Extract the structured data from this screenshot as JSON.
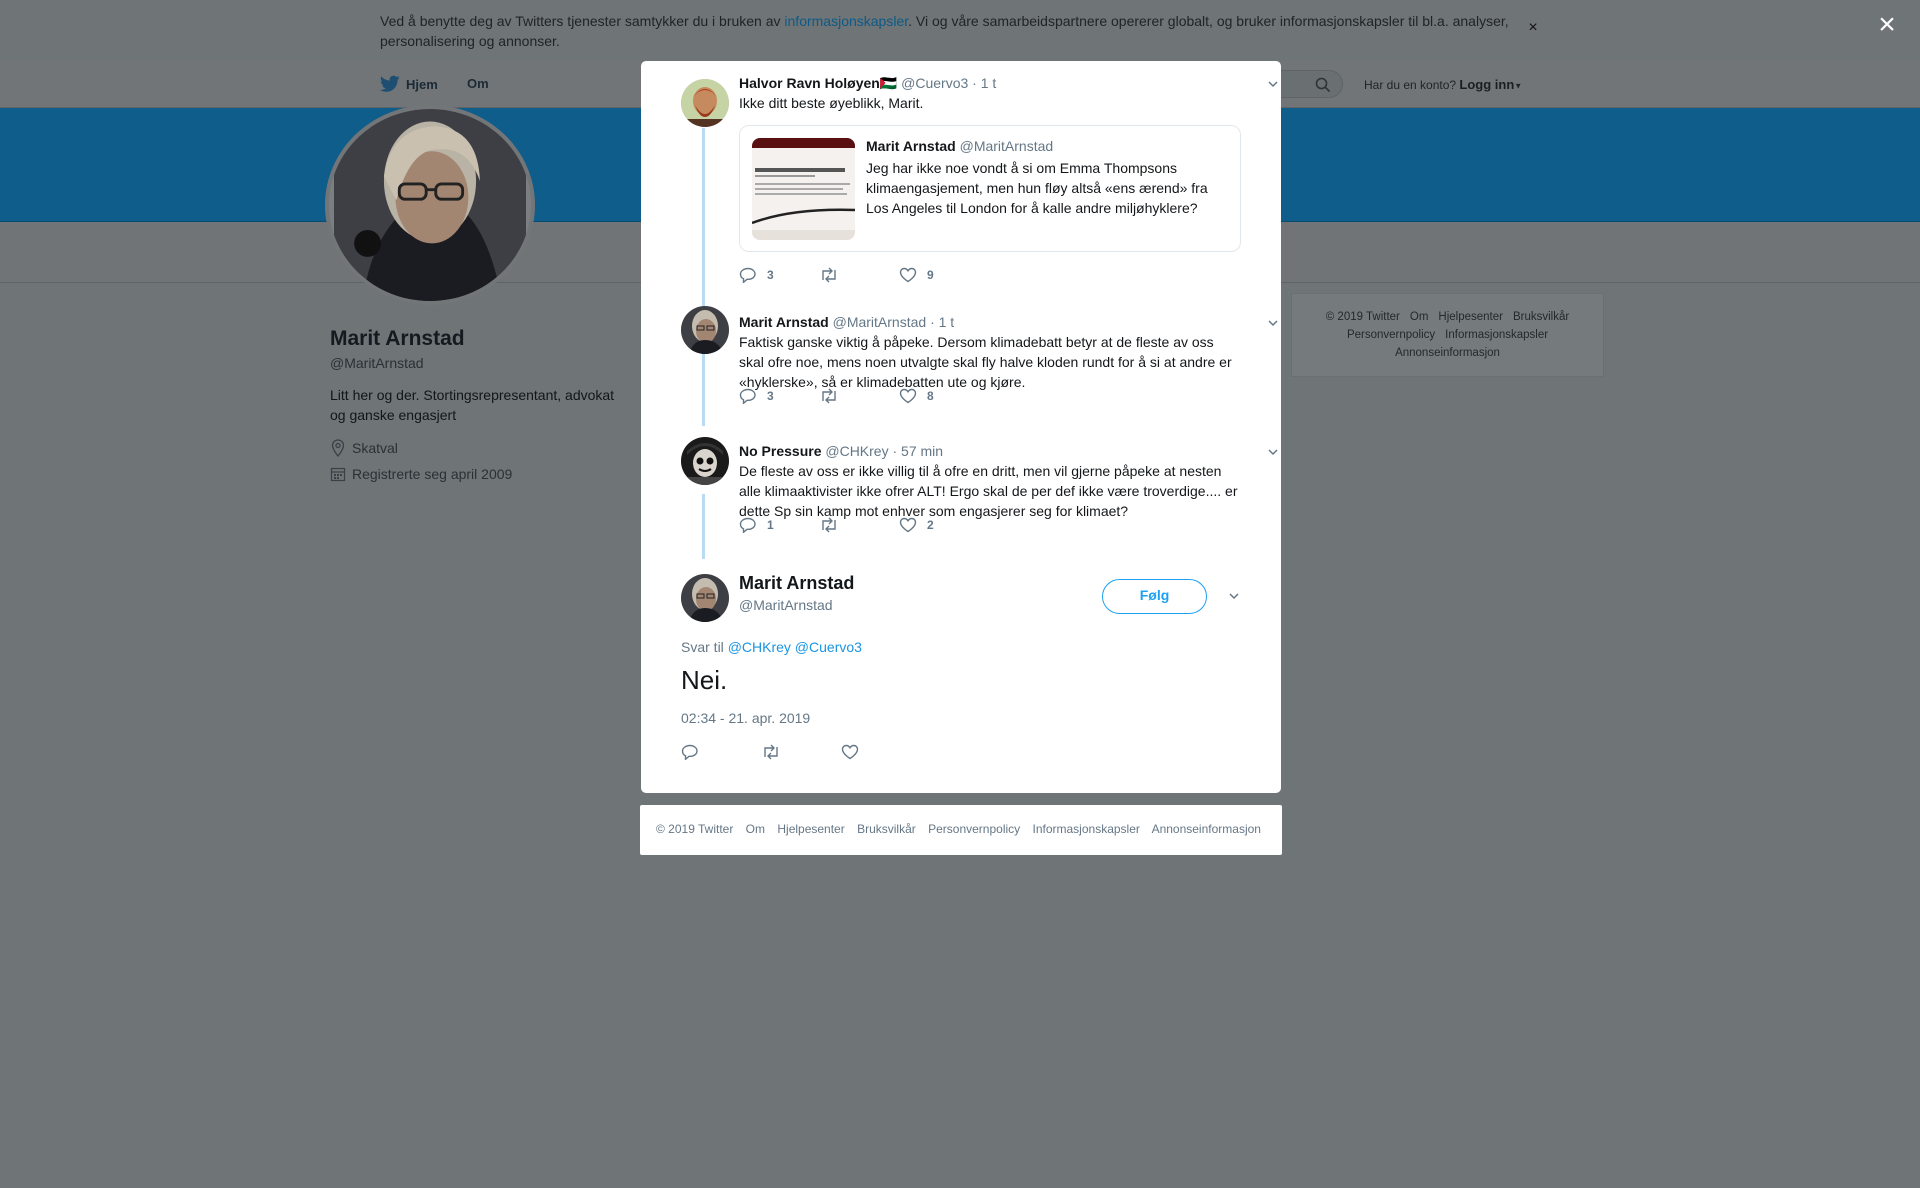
{
  "cookie": {
    "text_before": "Ved å benytte deg av Twitters tjenester samtykker du i bruken av ",
    "link": "informasjonskapsler",
    "text_after": ". Vi og våre samarbeidspartnere opererer globalt, og bruker informasjonskapsler til bl.a. analyser, personalisering og annonser.",
    "close": "×"
  },
  "overlay_close": "×",
  "nav": {
    "home": "Hjem",
    "about": "Om",
    "login_prompt": "Har du en konto?",
    "login": "Logg inn"
  },
  "profile": {
    "name": "Marit Arnstad",
    "handle": "@MaritArnstad",
    "bio": "Litt her og der. Stortingsrepresentant, advokat og ganske engasjert",
    "location": "Skatval",
    "joined": "Registrerte seg april 2009"
  },
  "side_footer": {
    "items": [
      "© 2019 Twitter",
      "Om",
      "Hjelpesenter",
      "Bruksvilkår",
      "Personvernpolicy",
      "Informasjonskapsler",
      "Annonseinformasjon"
    ]
  },
  "tweets": [
    {
      "name": "Halvor Ravn Holøyen🇵🇸",
      "handle": "@Cuervo3",
      "time": "· 1 t",
      "text": "Ikke ditt beste øyeblikk, Marit.",
      "replies": "3",
      "retweets": "",
      "likes": "9",
      "quote": {
        "name": "Marit Arnstad",
        "handle": "@MaritArnstad",
        "text": "Jeg har ikke noe vondt å si om Emma Thompsons klimaengasjement, men hun fløy altså «ens ærend» fra Los Angeles til London for å kalle andre miljøhyklere?"
      }
    },
    {
      "name": "Marit Arnstad",
      "handle": "@MaritArnstad",
      "time": "· 1 t",
      "text": "Faktisk ganske viktig å påpeke. Dersom klimadebatt betyr at de fleste av oss skal ofre noe, mens noen utvalgte skal fly halve kloden rundt for å si at andre er «hyklerske», så er klimadebatten ute og kjøre.",
      "replies": "3",
      "retweets": "",
      "likes": "8"
    },
    {
      "name": "No Pressure",
      "handle": "@CHKrey",
      "time": "· 57 min",
      "text": "De fleste av oss er ikke villig til å ofre en dritt, men vil gjerne påpeke at nesten alle klimaaktivister ikke ofrer ALT! Ergo skal de per def ikke være troverdige.... er dette Sp sin kamp mot enhver som engasjerer seg for klimaet?",
      "replies": "1",
      "retweets": "",
      "likes": "2"
    }
  ],
  "main_tweet": {
    "name": "Marit Arnstad",
    "handle": "@MaritArnstad",
    "follow": "Følg",
    "reply_prefix": "Svar til",
    "reply_to_1": "@CHKrey",
    "reply_to_2": "@Cuervo3",
    "text": "Nei.",
    "timestamp": "02:34 - 21. apr. 2019"
  },
  "modal_footer": {
    "items": [
      "© 2019 Twitter",
      "Om",
      "Hjelpesenter",
      "Bruksvilkår",
      "Personvernpolicy",
      "Informasjonskapsler",
      "Annonseinformasjon"
    ]
  },
  "colors": {
    "twitter_blue": "#1da1f2",
    "thread_line": "#b8dcf3",
    "overlay": "#6f7477",
    "banner": "#0f5d8a"
  }
}
